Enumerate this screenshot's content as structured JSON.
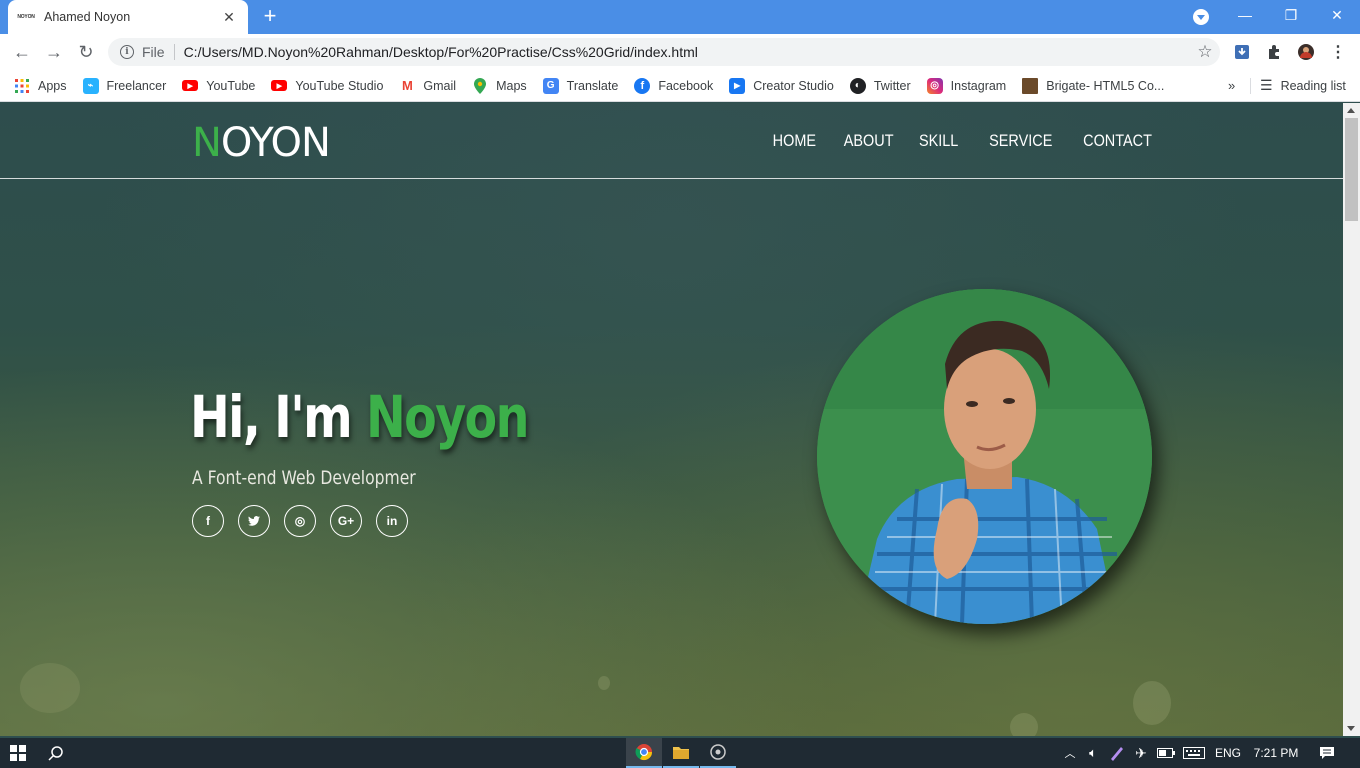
{
  "browser": {
    "tab": {
      "title": "Ahamed Noyon",
      "favicon_text": "NOYON"
    },
    "address": {
      "scheme_label": "File",
      "url": "C:/Users/MD.Noyon%20Rahman/Desktop/For%20Practise/Css%20Grid/index.html"
    },
    "bookmarks": [
      {
        "label": "Apps",
        "icon": "apps-grid-icon",
        "color": "#ea4335"
      },
      {
        "label": "Freelancer",
        "icon": "freelancer-icon",
        "color": "#29b2fe"
      },
      {
        "label": "YouTube",
        "icon": "youtube-icon",
        "color": "#ff0000"
      },
      {
        "label": "YouTube Studio",
        "icon": "youtube-icon",
        "color": "#ff0000"
      },
      {
        "label": "Gmail",
        "icon": "gmail-icon",
        "color": "#ea4335"
      },
      {
        "label": "Maps",
        "icon": "maps-icon",
        "color": "#34a853"
      },
      {
        "label": "Translate",
        "icon": "translate-icon",
        "color": "#4285f4"
      },
      {
        "label": "Facebook",
        "icon": "facebook-icon",
        "color": "#1877f2"
      },
      {
        "label": "Creator Studio",
        "icon": "creator-studio-icon",
        "color": "#1877f2"
      },
      {
        "label": "Twitter",
        "icon": "globe-icon",
        "color": "#202124"
      },
      {
        "label": "Instagram",
        "icon": "instagram-icon",
        "color": "#c13584"
      },
      {
        "label": "Brigate- HTML5 Co...",
        "icon": "brigate-icon",
        "color": "#6b4a2a"
      }
    ],
    "more_label": "»",
    "reading_list": "Reading list"
  },
  "site": {
    "logo_first": "N",
    "logo_rest": "OYON",
    "nav": [
      "HOME",
      "ABOUT",
      "SKILL",
      "SERVICE",
      "CONTACT"
    ],
    "hero": {
      "greeting": "Hi, I'm",
      "name": "Noyon",
      "subtitle": "A Font-end Web Developmer"
    },
    "socials": [
      {
        "name": "facebook",
        "glyph": "f"
      },
      {
        "name": "twitter",
        "glyph": "t"
      },
      {
        "name": "instagram",
        "glyph": "◎"
      },
      {
        "name": "google-plus",
        "glyph": "G+"
      },
      {
        "name": "linkedin",
        "glyph": "in"
      }
    ],
    "accent_color": "#3cb04a"
  },
  "taskbar": {
    "language": "ENG",
    "time": "7:21 PM"
  }
}
